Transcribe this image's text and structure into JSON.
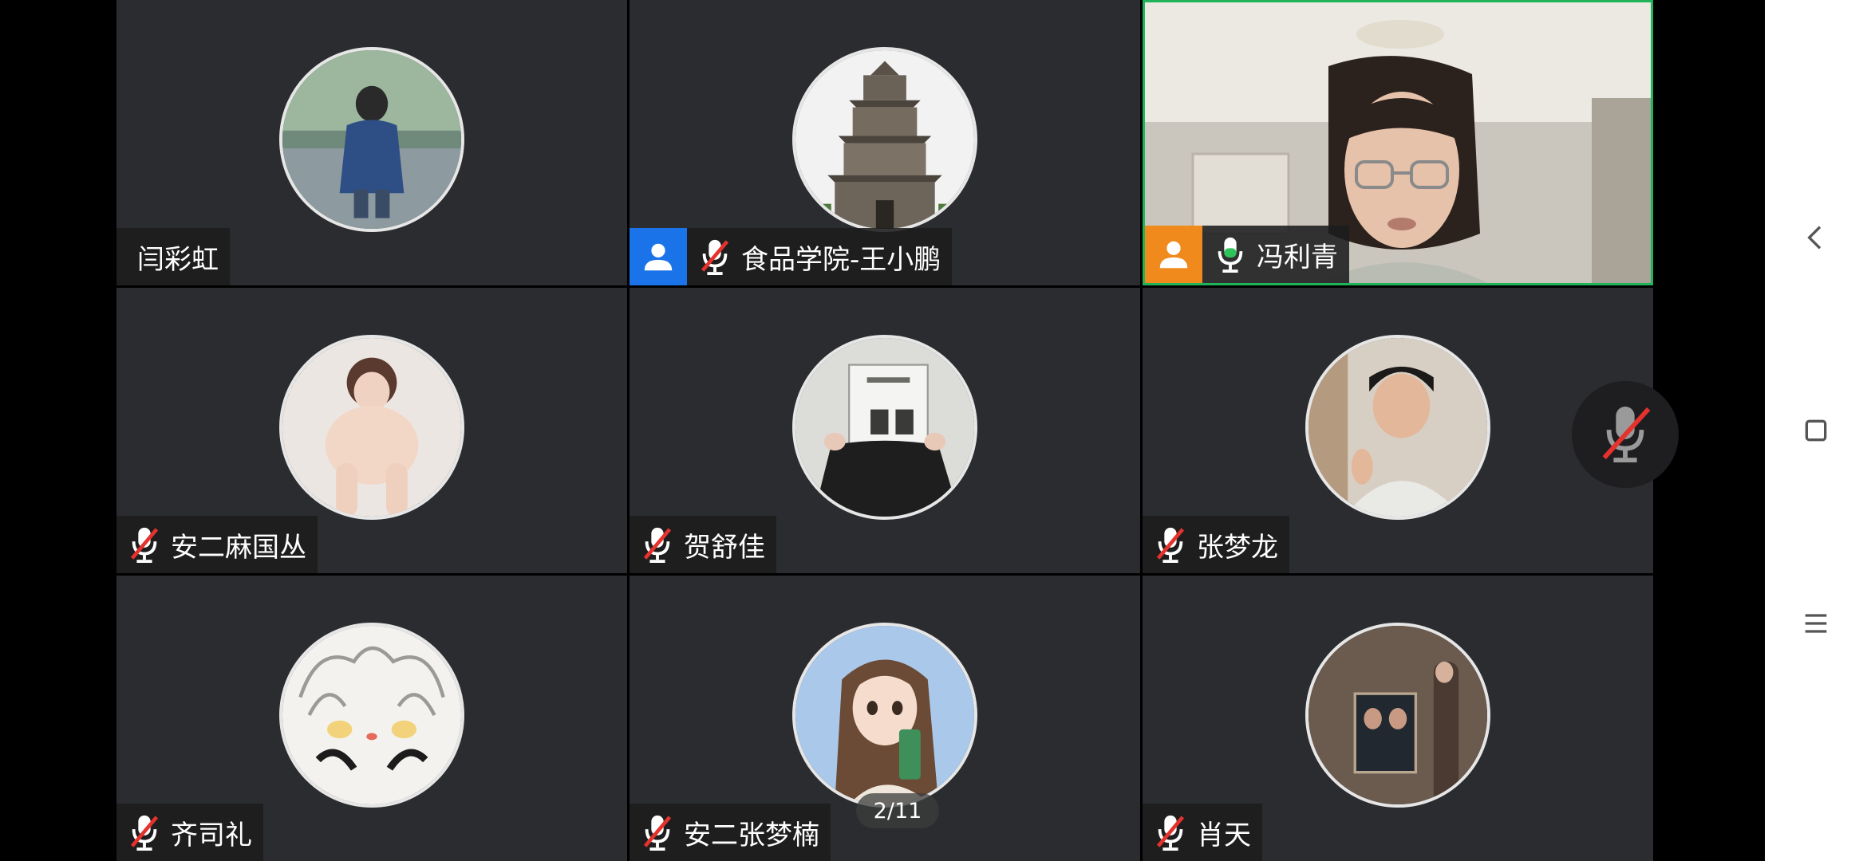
{
  "meeting": {
    "page_indicator": "2/11",
    "participants": [
      {
        "name": "闫彩虹",
        "mic": "none",
        "role": "none",
        "avatar": "avatar-photo-girl-blue-jacket"
      },
      {
        "name": "食品学院-王小鹏",
        "mic": "muted",
        "role": "host",
        "role_color": "#1a73e8",
        "avatar": "avatar-photo-pagoda"
      },
      {
        "name": "冯利青",
        "mic": "active",
        "role": "co-host",
        "role_color": "#f08a1c",
        "video": "on",
        "speaking": true
      },
      {
        "name": "安二麻国丛",
        "mic": "muted",
        "role": "none",
        "avatar": "avatar-photo-girl-sitting"
      },
      {
        "name": "贺舒佳",
        "mic": "muted",
        "role": "none",
        "avatar": "avatar-photo-book-cover"
      },
      {
        "name": "张梦龙",
        "mic": "muted",
        "role": "none",
        "avatar": "avatar-photo-man"
      },
      {
        "name": "齐司礼",
        "mic": "muted",
        "role": "none",
        "avatar": "avatar-anime-sketch"
      },
      {
        "name": "安二张梦楠",
        "mic": "muted",
        "role": "none",
        "avatar": "avatar-anime-girl"
      },
      {
        "name": "肖天",
        "mic": "muted",
        "role": "none",
        "avatar": "avatar-photo-wall-poster"
      }
    ]
  },
  "controls": {
    "floating_mic": "mic-muted-icon"
  },
  "nav": {
    "back": "back-icon",
    "home": "home-icon",
    "menu": "menu-icon"
  },
  "colors": {
    "tile_bg": "#2b2c2f",
    "speaking_border": "#1fb45a",
    "muted_red": "#e5322d",
    "mic_active_green": "#2fc35a"
  }
}
